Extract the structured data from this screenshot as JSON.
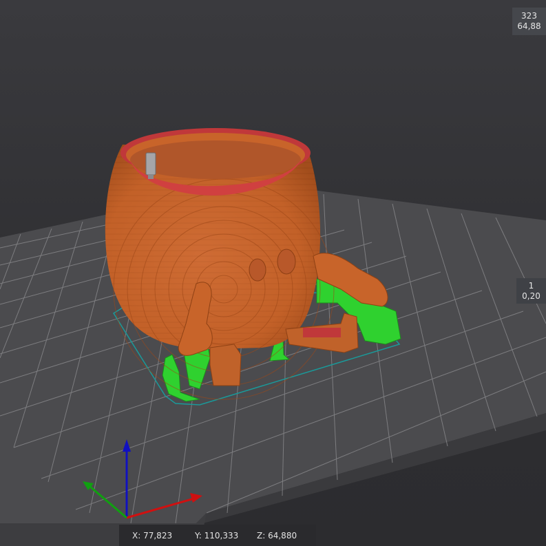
{
  "layer_slider": {
    "top": {
      "layer": "323",
      "height": "64,88"
    },
    "bottom": {
      "layer": "1",
      "height": "0,20"
    }
  },
  "coordinates": {
    "x_label": "X:",
    "x_value": "77,823",
    "y_label": "Y:",
    "y_value": "110,333",
    "z_label": "Z:",
    "z_value": "64,880"
  },
  "colors": {
    "background": "#2f2f32",
    "bed": "#4a4a4d",
    "grid": "#8e8e91",
    "model": "#c8642a",
    "model_dark": "#9a4618",
    "support": "#2fd12f",
    "inner_wall": "#c0383a",
    "skirt": "#1a9a9a",
    "axis_x": "#d01010",
    "axis_y": "#10a010",
    "axis_z": "#1010c0"
  },
  "icons": {
    "axes": "xyz-axes-gizmo-icon",
    "nozzle": "extruder-tool-icon"
  }
}
